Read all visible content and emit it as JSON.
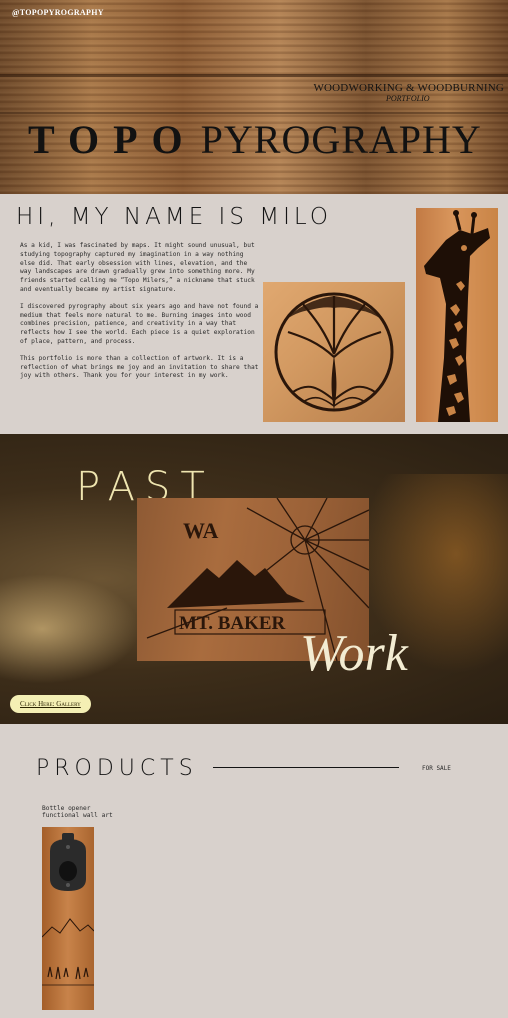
{
  "hero": {
    "handle": "@TOPOPYROGRAPHY",
    "tagline": "WOODWORKING & WOODBURNING",
    "portfolio": "PORTFOLIO",
    "title_bold": "TOPO",
    "title_rest": "PYROGRAPHY"
  },
  "about": {
    "heading": "HI, MY NAME IS MILO",
    "paragraphs": [
      "As a kid, I was fascinated by maps. It might sound unusual, but studying topography captured my imagination in a way nothing else did. That early obsession with lines, elevation, and the way landscapes are drawn gradually grew into something more. My friends started calling me “Topo Milers,” a nickname that stuck and eventually became my artist signature.",
      "I discovered pyrography about six years ago and have not found a medium that feels more natural to me. Burning images into wood combines precision, patience, and creativity in a way that reflects how I see the world. Each piece is a quiet exploration of place, pattern, and process.",
      "This portfolio is more than a collection of artwork. It is a reflection of what brings me joy and an invitation to share that joy with others. Thank you for your interest in my work."
    ]
  },
  "past": {
    "title": "PAST",
    "script": "Work",
    "gallery_button": "Click Here: Gallery",
    "board_text_top": "WA",
    "board_text_bottom": "MT. BAKER"
  },
  "products": {
    "title": "PRODUCTS",
    "for_sale": "FOR SALE",
    "caption_line1": "Bottle opener",
    "caption_line2": "functional wall art"
  }
}
